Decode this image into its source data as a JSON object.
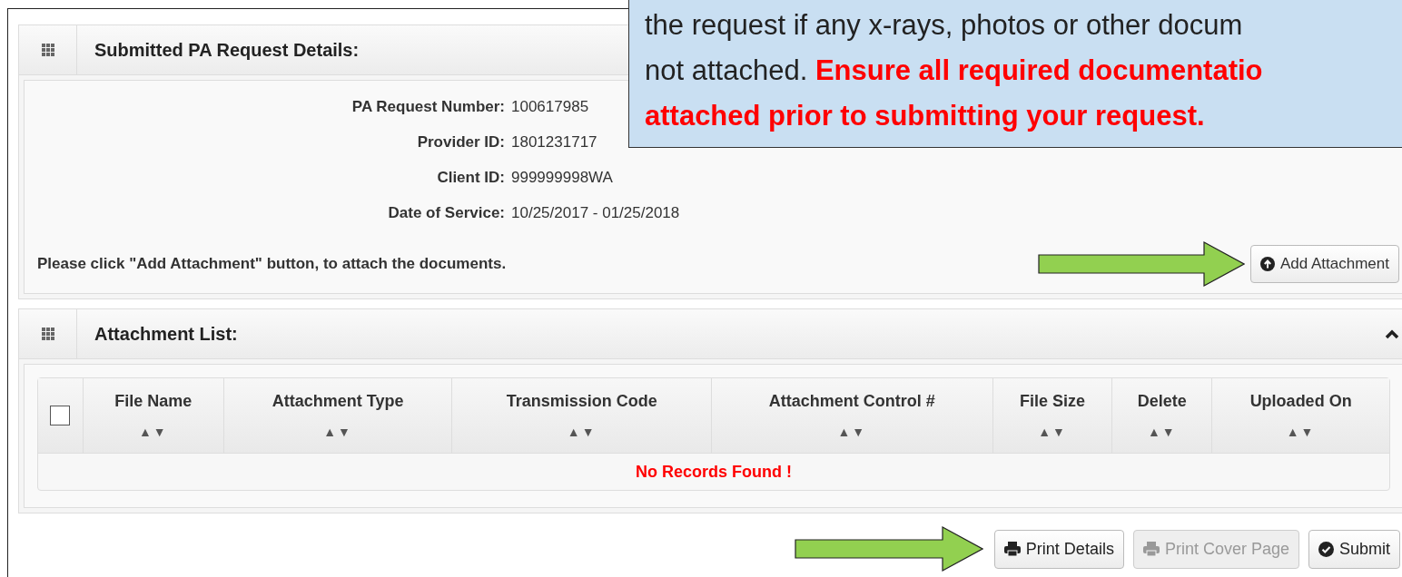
{
  "callout": {
    "lines": [
      "the request if any x-rays, photos or other docum",
      "not attached. **Ensure all required documentatio**",
      "**attached prior to submitting your request.**"
    ]
  },
  "details_panel": {
    "title": "Submitted PA Request Details:",
    "fields": [
      {
        "label": "PA Request Number:",
        "value": "100617985"
      },
      {
        "label": "Provider ID:",
        "value": "1801231717"
      },
      {
        "label": "Client ID:",
        "value": "999999998WA"
      },
      {
        "label": "Date of Service:",
        "value": "10/25/2017 - 01/25/2018"
      }
    ],
    "instruction": "Please click \"Add Attachment\" button, to attach the documents.",
    "add_button": "Add Attachment"
  },
  "attachment_panel": {
    "title": "Attachment List:",
    "expanded": true,
    "table": {
      "select_all_checked": false,
      "columns": [
        {
          "label": "File Name",
          "sort": "▲▼"
        },
        {
          "label": "Attachment Type",
          "sort": "▲▼"
        },
        {
          "label": "Transmission Code",
          "sort": "▲▼"
        },
        {
          "label": "Attachment Control #",
          "sort": "▲▼"
        },
        {
          "label": "File Size",
          "sort": "▲▼"
        },
        {
          "label": "Delete",
          "sort": "▲▼"
        },
        {
          "label": "Uploaded On",
          "sort": "▲▼"
        }
      ],
      "empty_message": "No Records Found !"
    }
  },
  "actions": [
    {
      "label": "Print Details",
      "kind": "print",
      "disabled": false
    },
    {
      "label": "Print Cover Page",
      "kind": "print",
      "disabled": true
    },
    {
      "label": "Submit",
      "kind": "submit",
      "disabled": false
    }
  ]
}
